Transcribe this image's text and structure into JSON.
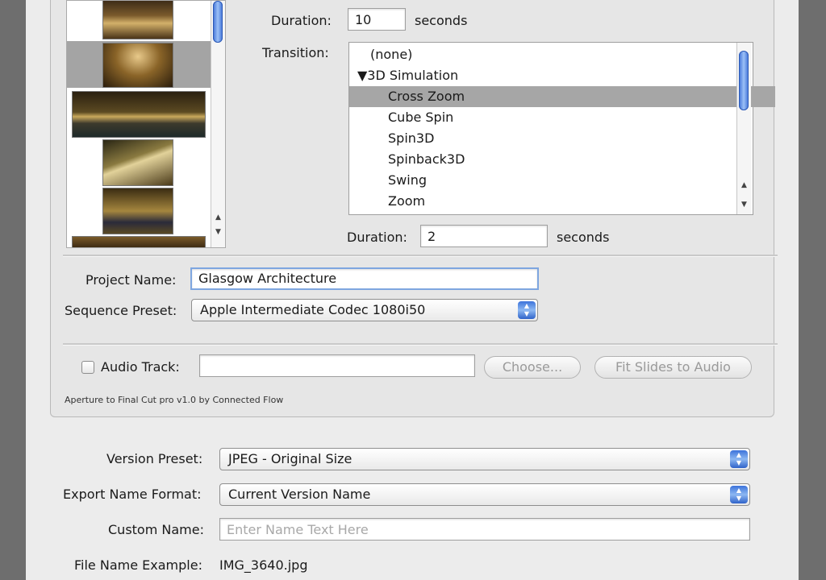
{
  "slides": {
    "items": [
      {
        "name": "slide-1",
        "selected": false
      },
      {
        "name": "slide-2",
        "selected": true
      },
      {
        "name": "slide-3",
        "selected": false
      },
      {
        "name": "slide-4",
        "selected": false
      },
      {
        "name": "slide-5",
        "selected": false
      }
    ]
  },
  "slide_duration": {
    "label": "Duration:",
    "value": "10",
    "unit": "seconds"
  },
  "transition": {
    "label": "Transition:",
    "items": [
      "(none)",
      "▼3D Simulation",
      "Cross Zoom",
      "Cube Spin",
      "Spin3D",
      "Spinback3D",
      "Swing",
      "Zoom"
    ],
    "selected": "Cross Zoom",
    "duration_label": "Duration:",
    "duration_value": "2",
    "duration_unit": "seconds"
  },
  "project": {
    "label": "Project Name:",
    "value": "Glasgow Architecture"
  },
  "sequence_preset": {
    "label": "Sequence Preset:",
    "value": "Apple Intermediate Codec 1080i50"
  },
  "audio": {
    "label": "Audio Track:",
    "value": "",
    "choose_label": "Choose...",
    "fit_label": "Fit Slides to Audio"
  },
  "credit": "Aperture to Final Cut pro v1.0 by Connected Flow",
  "export": {
    "version_preset_label": "Version Preset:",
    "version_preset_value": "JPEG - Original Size",
    "name_format_label": "Export Name Format:",
    "name_format_value": "Current Version Name",
    "custom_name_label": "Custom Name:",
    "custom_name_placeholder": "Enter Name Text Here",
    "file_example_label": "File Name Example:",
    "file_example_value": "IMG_3640.jpg"
  },
  "colors": {
    "accent": "#3d6fd6",
    "selection": "#a6a6a6",
    "background": "#ececec"
  }
}
